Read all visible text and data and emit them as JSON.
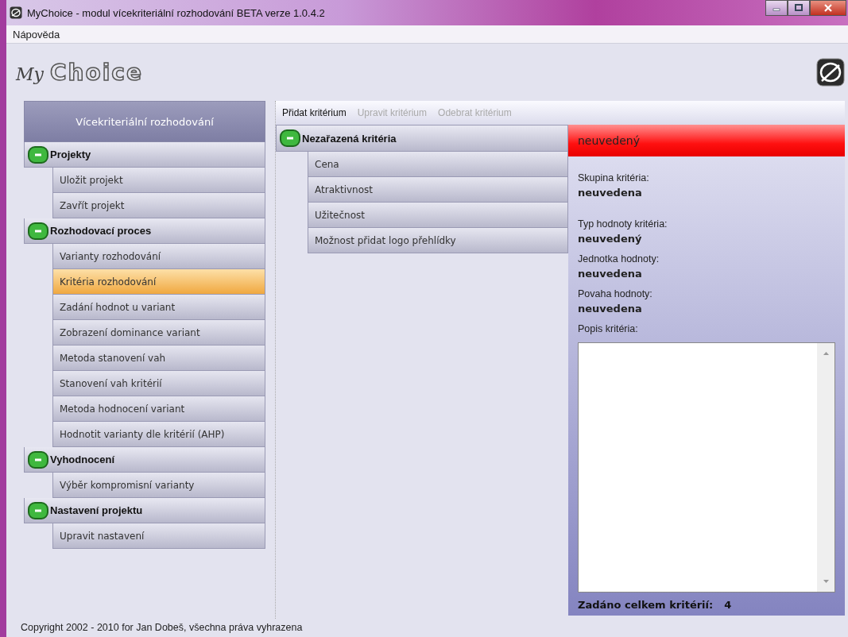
{
  "window": {
    "title": "MyChoice - modul vícekriteriální rozhodování BETA verze 1.0.4.2"
  },
  "menu": [
    "Nápověda"
  ],
  "logo": {
    "prefix": "My",
    "name": "Choice"
  },
  "sidebar": {
    "title": "Vícekriteriální rozhodování",
    "groups": [
      {
        "label": "Projekty",
        "expanded": true,
        "items": [
          {
            "label": "Uložit projekt",
            "selected": false
          },
          {
            "label": "Zavřít projekt",
            "selected": false
          }
        ]
      },
      {
        "label": "Rozhodovací proces",
        "expanded": true,
        "items": [
          {
            "label": "Varianty rozhodování",
            "selected": false
          },
          {
            "label": "Kritéria rozhodování",
            "selected": true
          },
          {
            "label": "Zadání hodnot u variant",
            "selected": false
          },
          {
            "label": "Zobrazení dominance variant",
            "selected": false
          },
          {
            "label": "Metoda stanovení vah",
            "selected": false
          },
          {
            "label": "Stanovení vah kritérií",
            "selected": false
          },
          {
            "label": "Metoda hodnocení variant",
            "selected": false
          },
          {
            "label": "Hodnotit varianty dle kritérií (AHP)",
            "selected": false
          }
        ]
      },
      {
        "label": "Vyhodnocení",
        "expanded": true,
        "items": [
          {
            "label": "Výběr kompromisní varianty",
            "selected": false
          }
        ]
      },
      {
        "label": "Nastavení projektu",
        "expanded": true,
        "items": [
          {
            "label": "Upravit nastavení",
            "selected": false
          }
        ]
      }
    ]
  },
  "toolbar": [
    {
      "label": "Přidat kritérium",
      "disabled": false
    },
    {
      "label": "Upravit kritérium",
      "disabled": true
    },
    {
      "label": "Odebrat kritérium",
      "disabled": true
    }
  ],
  "criteria_tree": {
    "label": "Nezařazená kritéria",
    "expanded": true,
    "items": [
      {
        "label": "Cena",
        "selected": false
      },
      {
        "label": "Atraktivnost",
        "selected": false
      },
      {
        "label": "Užitečnost",
        "selected": false
      },
      {
        "label": "Možnost přidat logo přehlídky",
        "selected": false
      }
    ]
  },
  "detail": {
    "header": "neuvedený",
    "fields": [
      {
        "label": "Skupina kritéria:",
        "value": "neuvedena"
      },
      {
        "label": "Typ hodnoty kritéria:",
        "value": "neuvedený"
      },
      {
        "label": "Jednotka hodnoty:",
        "value": "neuvedena"
      },
      {
        "label": "Povaha hodnoty:",
        "value": "neuvedena"
      }
    ],
    "description_label": "Popis kritéria:",
    "total_label": "Zadáno celkem kritérií:",
    "total": "4"
  },
  "status_bar": "Copyright 2002 - 2010 for Jan Dobeš, všechna práva vyhrazena"
}
